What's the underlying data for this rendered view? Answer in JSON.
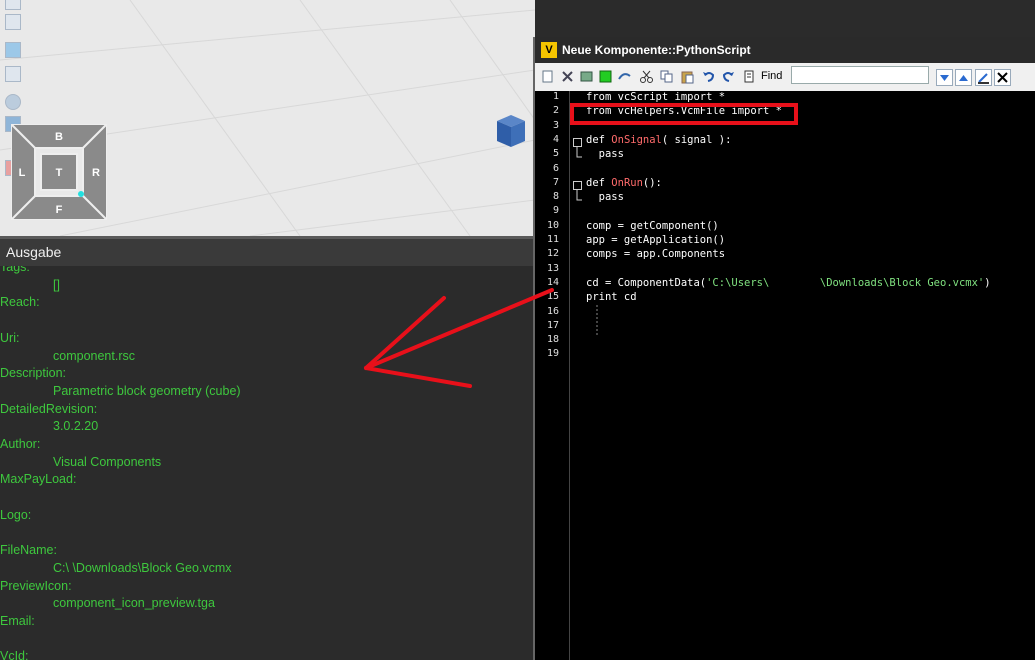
{
  "viewport": {
    "navcube": {
      "top": "B",
      "left": "L",
      "center": "T",
      "right": "R",
      "bottom": "F"
    }
  },
  "output": {
    "title": "Ausgabe",
    "lines": [
      {
        "text": "Tags:",
        "kind": "key"
      },
      {
        "text": "[]",
        "kind": "val"
      },
      {
        "text": "Reach:",
        "kind": "key"
      },
      {
        "text": "",
        "kind": "val"
      },
      {
        "text": "Uri:",
        "kind": "key"
      },
      {
        "text": "component.rsc",
        "kind": "val"
      },
      {
        "text": "Description:",
        "kind": "key"
      },
      {
        "text": "Parametric block geometry (cube)",
        "kind": "val"
      },
      {
        "text": "DetailedRevision:",
        "kind": "key"
      },
      {
        "text": "3.0.2.20",
        "kind": "val"
      },
      {
        "text": "Author:",
        "kind": "key"
      },
      {
        "text": "Visual Components",
        "kind": "val"
      },
      {
        "text": "MaxPayLoad:",
        "kind": "key"
      },
      {
        "text": "",
        "kind": "val"
      },
      {
        "text": "Logo:",
        "kind": "key"
      },
      {
        "text": "",
        "kind": "val"
      },
      {
        "text": "FileName:",
        "kind": "key"
      },
      {
        "text": "C:\\                              \\Downloads\\Block Geo.vcmx",
        "kind": "val"
      },
      {
        "text": "PreviewIcon:",
        "kind": "key"
      },
      {
        "text": "component_icon_preview.tga",
        "kind": "val"
      },
      {
        "text": "Email:",
        "kind": "key"
      },
      {
        "text": "",
        "kind": "val"
      },
      {
        "text": "VcId:",
        "kind": "key"
      }
    ]
  },
  "script": {
    "title": "Neue Komponente::PythonScript",
    "find_label": "Find",
    "find_value": "",
    "line_numbers": [
      "1",
      "2",
      "3",
      "4",
      "5",
      "6",
      "7",
      "8",
      "9",
      "10",
      "11",
      "12",
      "13",
      "14",
      "15",
      "16",
      "17",
      "18",
      "19"
    ],
    "code": [
      "from vcScript import *",
      "from vcHelpers.VcmFile import *",
      "",
      "def OnSignal( signal ):",
      "  pass",
      "",
      "def OnRun():",
      "  pass",
      "",
      "comp = getComponent()",
      "app = getApplication()",
      "comps = app.Components",
      "",
      "cd = ComponentData('C:\\Users\\        \\Downloads\\Block Geo.vcmx')",
      "print cd",
      "",
      "",
      "",
      ""
    ]
  },
  "colors": {
    "output_text": "#3ec83e",
    "highlight": "#e8101a",
    "arrow": "#e8101a"
  }
}
